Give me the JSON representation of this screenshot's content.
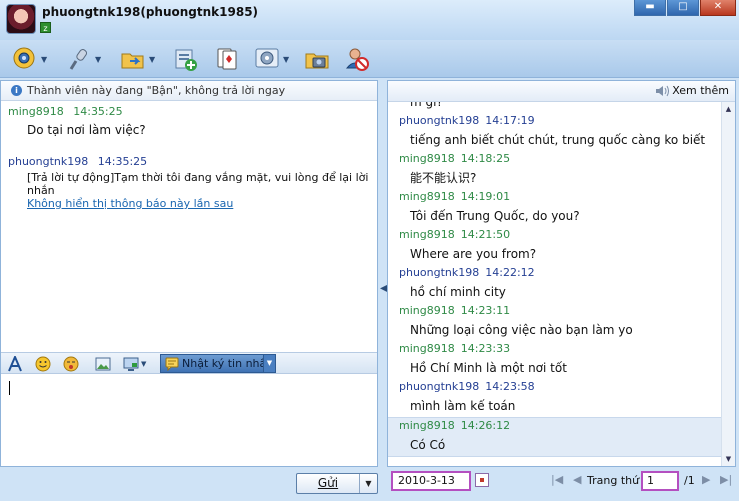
{
  "window": {
    "title": "phuongtnk198(phuongtnk1985)",
    "minimize": "▬",
    "maximize": "□",
    "close": "✕"
  },
  "toolbar": {
    "icons": [
      "webcam-icon",
      "microphone-icon",
      "send-file-icon",
      "add-contact-icon",
      "games-icon",
      "settings-icon",
      "photo-icon",
      "block-user-icon"
    ]
  },
  "left": {
    "notice": "Thành viên này đang \"Bận\", không trả lời ngay",
    "messages": [
      {
        "sender": "ming8918",
        "time": "14:35:25",
        "text": "Do tại nơi làm việc?"
      },
      {
        "sender": "phuongtnk198",
        "time": "14:35:25",
        "text": "[Trả lời tự động]Tạm thời tôi đang vắng mặt, vui lòng để lại lời nhắn",
        "link": "Không hiển thị thông báo này lần sau"
      }
    ],
    "history_button": "Nhật ký tin nhắn",
    "send_button": "Gửi"
  },
  "right": {
    "more_button": "Xem thêm",
    "partial_top": "m gì?",
    "history": [
      {
        "sender": "phuongtnk198",
        "time": "14:17:19",
        "text": "tiếng anh biết chút chút, trung quốc càng ko biết"
      },
      {
        "sender": "ming8918",
        "time": "14:18:25",
        "text": "能不能认识?"
      },
      {
        "sender": "ming8918",
        "time": "14:19:01",
        "text": "Tôi đến Trung Quốc, do you?"
      },
      {
        "sender": "ming8918",
        "time": "14:21:50",
        "text": "Where are you from?"
      },
      {
        "sender": "phuongtnk198",
        "time": "14:22:12",
        "text": "hồ chí minh city"
      },
      {
        "sender": "ming8918",
        "time": "14:23:11",
        "text": "Những loại công việc nào bạn làm yo"
      },
      {
        "sender": "ming8918",
        "time": "14:23:33",
        "text": "Hồ Chí Minh là một nơi tốt"
      },
      {
        "sender": "phuongtnk198",
        "time": "14:23:58",
        "text": "mình làm kế toán"
      },
      {
        "sender": "ming8918",
        "time": "14:26:12",
        "text": "Có Có"
      }
    ],
    "pager": {
      "date": "2010-3-13",
      "page_label": "Trang thứ",
      "page": "1",
      "total": "/1"
    }
  },
  "colors": {
    "sender_green": "#2f8a46",
    "sender_blue": "#243f93",
    "highlight_border": "#b44fc0",
    "link": "#1a66b0"
  }
}
